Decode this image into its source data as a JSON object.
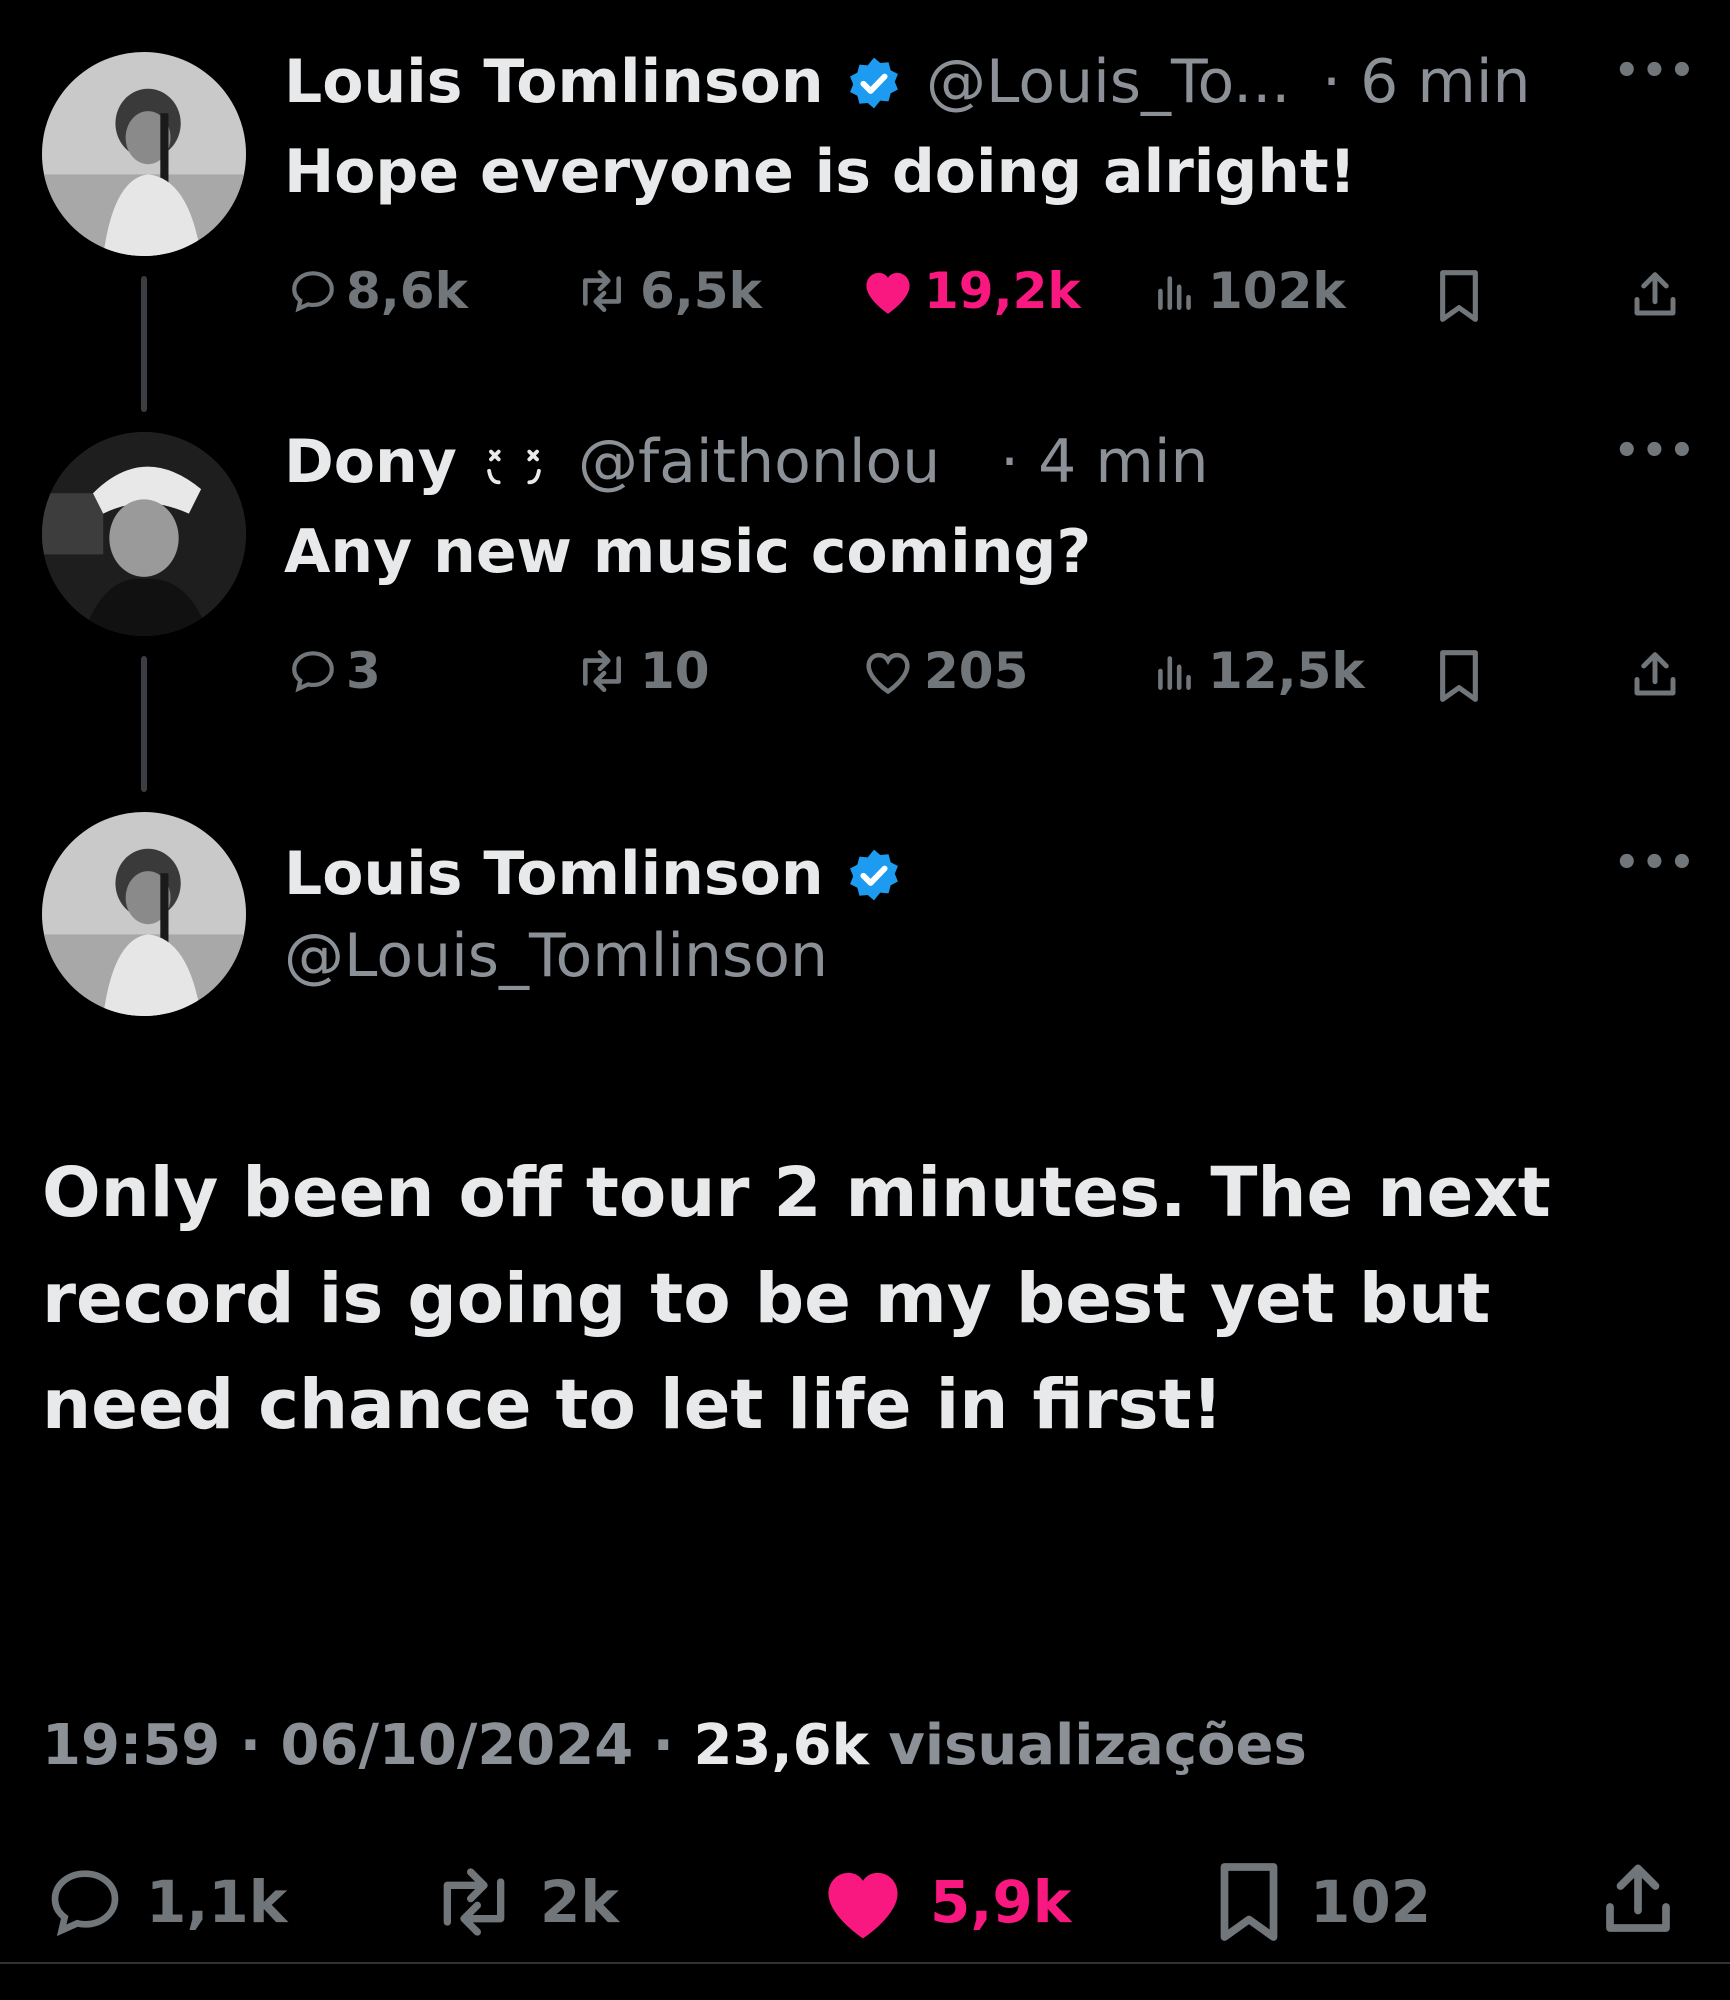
{
  "colors": {
    "background": "#000000",
    "text": "#e7e9ea",
    "muted": "#71767b",
    "like": "#f91880",
    "verified": "#1d9bf0"
  },
  "tweet1": {
    "name": "Louis Tomlinson",
    "handle": "@Louis_To...",
    "time": "· 6 min",
    "text": "Hope everyone is doing alright!",
    "replies": "8,6k",
    "retweets": "6,5k",
    "likes": "19,2k",
    "views": "102k",
    "liked": true
  },
  "tweet2": {
    "name": "Dony",
    "name_emoji": "face-icon",
    "handle": "@faithonlou",
    "time": "· 4 min",
    "text": "Any new music coming?",
    "replies": "3",
    "retweets": "10",
    "likes": "205",
    "views": "12,5k",
    "liked": false
  },
  "main": {
    "name": "Louis Tomlinson",
    "handle": "@Louis_Tomlinson",
    "text": "Only been off tour 2 minutes. The next record is going to be my best yet but need chance to let life in first!",
    "time": "19:59",
    "date": "06/10/2024",
    "sep": "·",
    "views_count": "23,6k",
    "views_label": "visualizações",
    "replies": "1,1k",
    "retweets": "2k",
    "likes": "5,9k",
    "bookmarks": "102",
    "liked": true
  }
}
